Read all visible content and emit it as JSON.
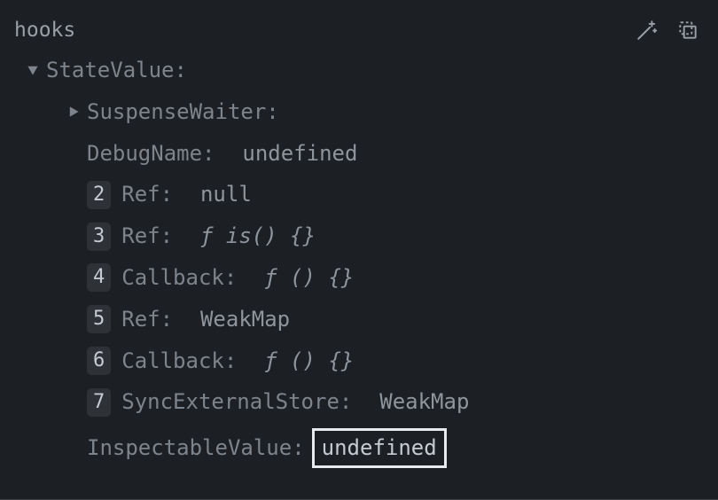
{
  "header": {
    "title": "hooks"
  },
  "tree": {
    "root": {
      "label": "StateValue",
      "colon": ":"
    },
    "node1": {
      "label": "SuspenseWaiter",
      "colon": ":"
    },
    "node2": {
      "label": "DebugName",
      "colon": ":",
      "value": "undefined"
    },
    "items": [
      {
        "badge": "2",
        "label": "Ref",
        "colon": ":",
        "value": "null"
      },
      {
        "badge": "3",
        "label": "Ref",
        "colon": ":",
        "value": "ƒ is() {}"
      },
      {
        "badge": "4",
        "label": "Callback",
        "colon": ":",
        "value": "ƒ () {}"
      },
      {
        "badge": "5",
        "label": "Ref",
        "colon": ":",
        "value": "WeakMap"
      },
      {
        "badge": "6",
        "label": "Callback",
        "colon": ":",
        "value": "ƒ () {}"
      },
      {
        "badge": "7",
        "label": "SyncExternalStore",
        "colon": ":",
        "value": "WeakMap"
      }
    ],
    "inspectable": {
      "label": "InspectableValue",
      "colon": ":",
      "value": "undefined"
    }
  }
}
